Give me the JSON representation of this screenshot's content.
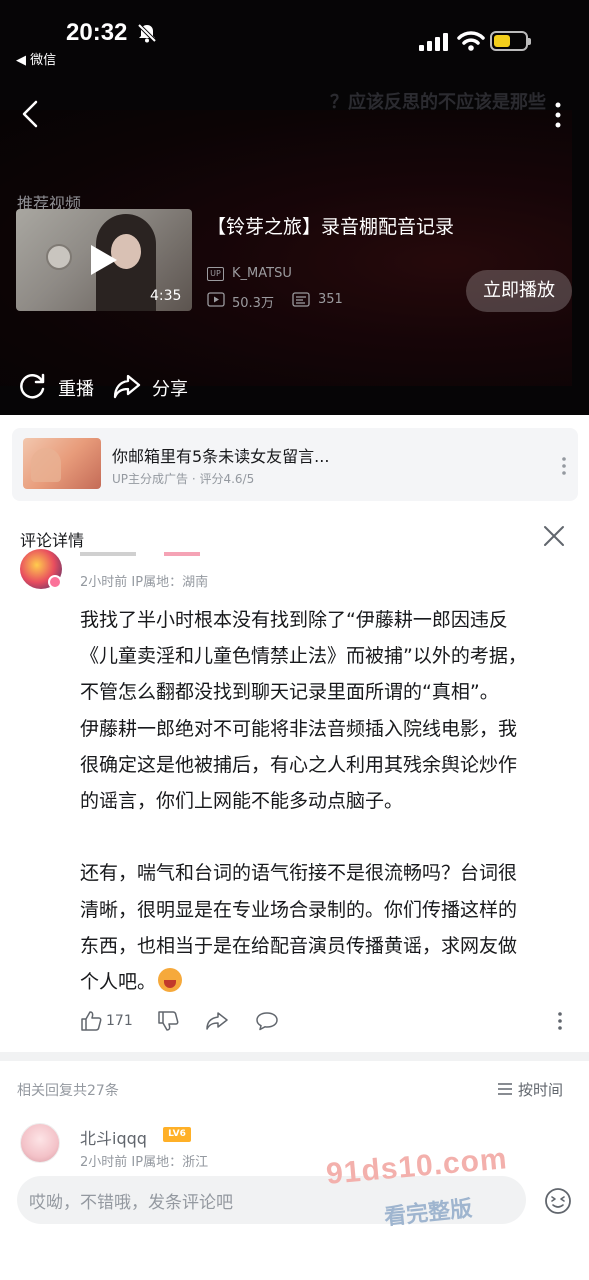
{
  "status_bar": {
    "time": "20:32",
    "back_app": "◀ 微信"
  },
  "video": {
    "top_caption": "？应该反思的不应该是那些",
    "recommend_label": "推荐视频",
    "duration": "4:35",
    "title": "【铃芽之旅】录音棚配音记录",
    "up_badge": "UP",
    "uploader": "K_MATSU",
    "views": "50.3万",
    "danmaku_count": "351",
    "play_now": "立即播放",
    "replay": "重播",
    "share": "分享"
  },
  "ad": {
    "title": "你邮箱里有5条未读女友留言...",
    "subtitle": "UP主分成广告 · 评分4.6/5"
  },
  "comment_panel": {
    "title": "评论详情",
    "main_comment": {
      "meta": "2小时前  IP属地：湖南",
      "lines": [
        "我找了半小时根本没有找到除了“伊藤耕一郎因违反",
        "《儿童卖淫和儿童色情禁止法》而被捕”以外的考据，",
        "不管怎么翻都没找到聊天记录里面所谓的“真相”。",
        "伊藤耕一郎绝对不可能将非法音频插入院线电影，我",
        "很确定这是他被捕后，有心之人利用其残余舆论炒作",
        "的谣言，你们上网能不能多动点脑子。",
        "",
        "还有，喘气和台词的语气衔接不是很流畅吗？台词很",
        "清晰，很明显是在专业场合录制的。你们传播这样的",
        "东西，也相当于是在给配音演员传播黄谣，求网友做",
        "个人吧。"
      ],
      "likes": "171"
    },
    "replies_label": "相关回复共27条",
    "sort_label": "按时间",
    "reply": {
      "name": "北斗iqqq",
      "level": "LV6",
      "meta": "2小时前  IP属地：浙江"
    },
    "input_placeholder": "哎呦，不错哦，发条评论吧"
  },
  "watermark": {
    "url": "91ds10.com",
    "sub": "看完整版"
  }
}
